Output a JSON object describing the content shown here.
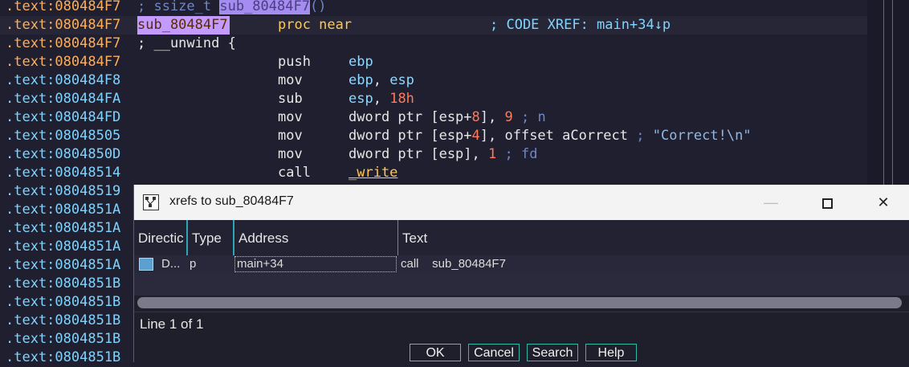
{
  "listing": {
    "lines": [
      {
        "addr": ".text:080484F7",
        "addr_color": "orange",
        "comment_prefix": "; ssize_t ",
        "comment_ident": "sub_80484F7",
        "comment_suffix": "()"
      },
      {
        "addr": ".text:080484F7",
        "addr_color": "orange",
        "label": "sub_80484F7",
        "keyword": "proc near",
        "xref": "; CODE XREF: main+34↓p"
      },
      {
        "addr": ".text:080484F7",
        "addr_color": "orange",
        "directive": "; __unwind {"
      },
      {
        "addr": ".text:080484F7",
        "addr_color": "orange",
        "mnemonic": "push",
        "op1": "ebp"
      },
      {
        "addr": ".text:080484F8",
        "mnemonic": "mov",
        "op1": "ebp",
        "op_sep": ", ",
        "op2": "esp"
      },
      {
        "addr": ".text:080484FA",
        "mnemonic": "sub",
        "op1": "esp",
        "op_sep": ", ",
        "op2_num": "18h"
      },
      {
        "addr": ".text:080484FD",
        "mnemonic": "mov",
        "op_a": "dword ptr [esp+",
        "op_a_num": "8",
        "op_b": "], ",
        "op_c_num": "9",
        "cmt": " ; n"
      },
      {
        "addr": ".text:08048505",
        "mnemonic": "mov",
        "op_a": "dword ptr [esp+",
        "op_a_num": "4",
        "op_b": "], offset aCorrect",
        "cmt": " ; ",
        "str": "\"Correct!\\n\""
      },
      {
        "addr": ".text:0804850D",
        "mnemonic": "mov",
        "op_a": "dword ptr [esp], ",
        "op_c_num": "1",
        "cmt": " ; fd"
      },
      {
        "addr": ".text:08048514",
        "mnemonic": "call",
        "fn": "_write"
      },
      {
        "addr": ".text:08048519"
      },
      {
        "addr": ".text:0804851A"
      },
      {
        "addr": ".text:0804851A"
      },
      {
        "addr": ".text:0804851A"
      },
      {
        "addr": ".text:0804851A"
      },
      {
        "addr": ".text:0804851B"
      },
      {
        "addr": ".text:0804851B"
      },
      {
        "addr": ".text:0804851B"
      },
      {
        "addr": ".text:0804851B"
      },
      {
        "addr": ".text:0804851B"
      }
    ]
  },
  "dialog": {
    "title": "xrefs to sub_80484F7",
    "minimize_glyph": "—",
    "close_glyph": "✕",
    "columns": [
      "Directic",
      "Type",
      "Address",
      "Text"
    ],
    "rows": [
      {
        "direction": "D...",
        "type": "p",
        "address": "main+34",
        "text": "call    sub_80484F7"
      }
    ],
    "status": "Line 1 of 1",
    "buttons": {
      "ok": "OK",
      "cancel": "Cancel",
      "search": "Search",
      "help": "Help"
    }
  },
  "colors": {
    "background": "#1f1f2f",
    "address": "#7ed4ff",
    "address_highlight": "#ffae5c",
    "keyword": "#ffc850",
    "number": "#ff7a5a",
    "accent": "#2aa6b4"
  },
  "icons": {
    "dialog": "xref-graph-icon",
    "row": "xref-graph-icon"
  }
}
